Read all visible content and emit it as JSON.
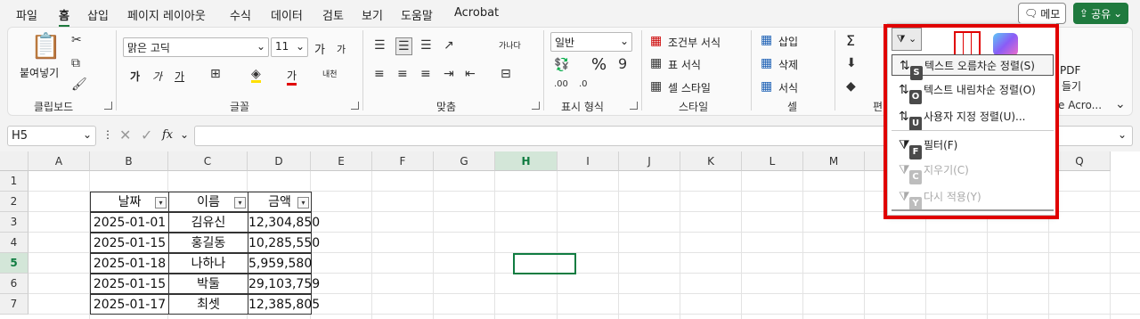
{
  "tabs": [
    "파일",
    "홈",
    "삽입",
    "페이지 레이아웃",
    "수식",
    "데이터",
    "검토",
    "보기",
    "도움말",
    "Acrobat"
  ],
  "top_buttons": {
    "memo": "메모",
    "share": "공유"
  },
  "ribbon": {
    "clipboard": {
      "paste": "붙여넣기",
      "group": "클립보드"
    },
    "font": {
      "name": "맑은 고딕",
      "size": "11",
      "group": "글꼴",
      "increase": "가",
      "decrease": "가",
      "bold": "가",
      "italic": "가",
      "underline": "가",
      "strike": "내천",
      "font_color_letter": "가"
    },
    "align": {
      "group": "맞춤",
      "wrap": "가나다"
    },
    "number": {
      "format": "일반",
      "group": "표시 형식",
      "percent": "%"
    },
    "styles": {
      "group": "스타일",
      "conditional": "조건부 서식",
      "table": "표 서식",
      "cell": "셀 스타일"
    },
    "cells": {
      "group": "셀",
      "insert": "삽입",
      "delete": "삭제",
      "format": "서식"
    },
    "edit": {
      "group": "편",
      "sum": "Σ"
    },
    "pdf": {
      "label": "PDF",
      "label2": "들기",
      "group": "e Acro..."
    }
  },
  "namebox": "H5",
  "fx": "fx",
  "columns": [
    "A",
    "B",
    "C",
    "D",
    "E",
    "F",
    "G",
    "H",
    "I",
    "J",
    "K",
    "L",
    "M",
    "N",
    "O",
    "P",
    "Q"
  ],
  "rows": [
    "1",
    "2",
    "3",
    "4",
    "5",
    "6",
    "7"
  ],
  "table": {
    "headers": [
      "날짜",
      "이름",
      "금액"
    ],
    "rows": [
      [
        "2025-01-01",
        "김유신",
        "12,304,850"
      ],
      [
        "2025-01-15",
        "홍길동",
        "10,285,550"
      ],
      [
        "2025-01-18",
        "나하나",
        "5,959,580"
      ],
      [
        "2025-01-15",
        "박둘",
        "29,103,759"
      ],
      [
        "2025-01-17",
        "최셋",
        "12,385,805"
      ]
    ]
  },
  "sort_menu": {
    "items": [
      {
        "label": "텍스트 오름차순 정렬(S)",
        "key": "S",
        "icon": "sort-ascending-icon",
        "enabled": true
      },
      {
        "label": "텍스트 내림차순 정렬(O)",
        "key": "O",
        "icon": "sort-descending-icon",
        "enabled": true
      },
      {
        "label": "사용자 지정 정렬(U)...",
        "key": "U",
        "icon": "custom-sort-icon",
        "enabled": true
      },
      {
        "label": "필터(F)",
        "key": "F",
        "icon": "filter-icon",
        "enabled": true
      },
      {
        "label": "지우기(C)",
        "key": "C",
        "icon": "clear-filter-icon",
        "enabled": false
      },
      {
        "label": "다시 적용(Y)",
        "key": "Y",
        "icon": "reapply-filter-icon",
        "enabled": false
      }
    ]
  },
  "colors": {
    "accent": "#107c41",
    "highlight_box": "#e00000",
    "share_bg": "#1f7a3e"
  }
}
